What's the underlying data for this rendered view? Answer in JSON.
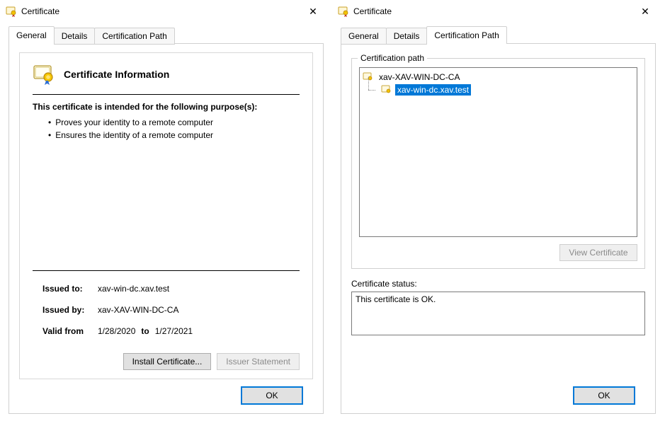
{
  "window_title": "Certificate",
  "close_glyph": "✕",
  "tabs": {
    "general": "General",
    "details": "Details",
    "certpath": "Certification Path"
  },
  "general": {
    "heading": "Certificate Information",
    "intro": "This certificate is intended for the following purpose(s):",
    "purposes": [
      "Proves your identity to a remote computer",
      "Ensures the identity of a remote computer"
    ],
    "issued_to_label": "Issued to:",
    "issued_to": "xav-win-dc.xav.test",
    "issued_by_label": "Issued by:",
    "issued_by": "xav-XAV-WIN-DC-CA",
    "valid_from_label": "Valid from",
    "valid_from": "1/28/2020",
    "valid_to_label": "to",
    "valid_to": "1/27/2021",
    "install_button": "Install Certificate...",
    "issuer_button": "Issuer Statement",
    "ok_button": "OK"
  },
  "certpath": {
    "group_label": "Certification path",
    "root_node": "xav-XAV-WIN-DC-CA",
    "leaf_node": "xav-win-dc.xav.test",
    "view_cert_button": "View Certificate",
    "status_label": "Certificate status:",
    "status_text": "This certificate is OK.",
    "ok_button": "OK"
  }
}
